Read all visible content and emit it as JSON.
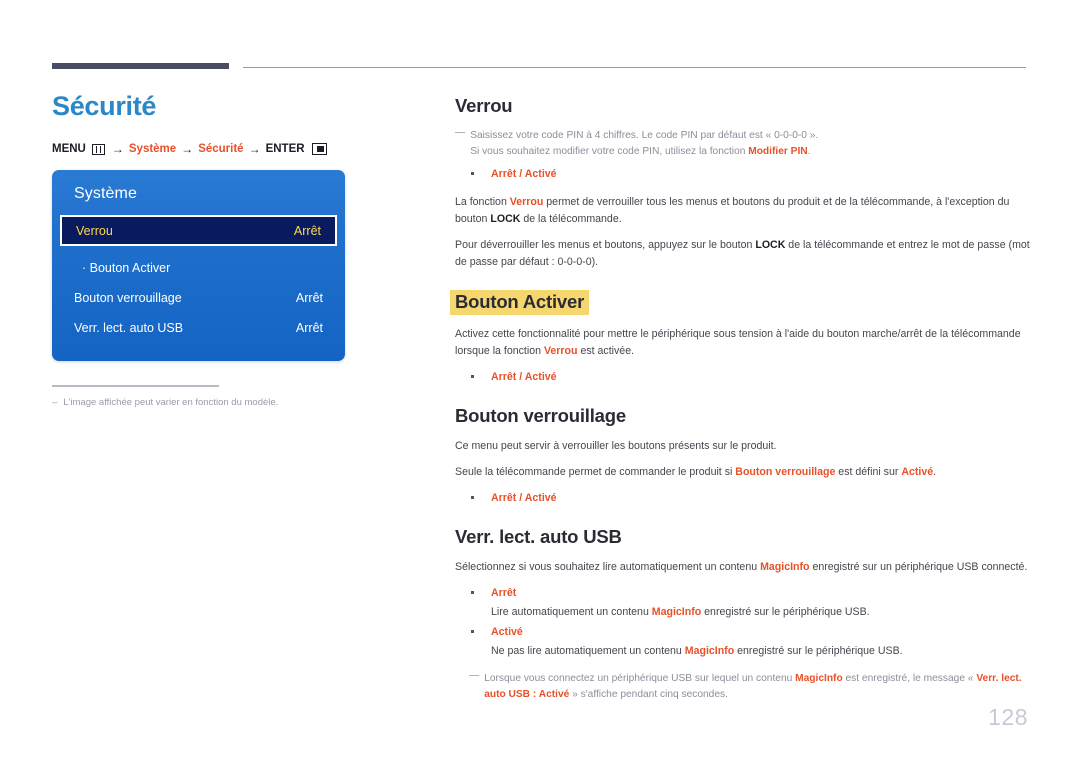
{
  "page": {
    "title": "Sécurité",
    "number": "128",
    "accent_color": "#2a87c8",
    "highlight_color": "#f5d76e",
    "link_color": "#e8512a"
  },
  "menu_path": {
    "prefix": "MENU",
    "menu_icon": "menu-grid-icon",
    "arrow": "→",
    "step1": "Système",
    "step2": "Sécurité",
    "enter": "ENTER",
    "enter_icon": "enter-key-icon"
  },
  "osd": {
    "title": "Système",
    "rows": [
      {
        "label": "Verrou",
        "value": "Arrêt",
        "selected": true,
        "sub": false
      },
      {
        "label": "Bouton Activer",
        "value": "",
        "selected": false,
        "sub": true
      },
      {
        "label": "Bouton verrouillage",
        "value": "Arrêt",
        "selected": false,
        "sub": false
      },
      {
        "label": "Verr. lect. auto USB",
        "value": "Arrêt",
        "selected": false,
        "sub": false
      }
    ]
  },
  "left_note": {
    "dash": "‒",
    "text": "L'image affichée peut varier en fonction du modèle."
  },
  "sections": {
    "verrou": {
      "heading": "Verrou",
      "note_dash": "—",
      "note_line1": "Saisissez votre code PIN à 4 chiffres. Le code PIN par défaut est « 0-0-0-0 ».",
      "note_line2_a": "Si vous souhaitez modifier votre code PIN, utilisez la fonction ",
      "note_line2_b": "Modifier PIN",
      "note_line2_c": ".",
      "options": [
        "Arrêt / Activé"
      ],
      "para1_a": "La fonction ",
      "para1_b": "Verrou",
      "para1_c": " permet de verrouiller tous les menus et boutons du produit et de la télécommande, à l'exception du bouton ",
      "para1_d": "LOCK",
      "para1_e": " de la télécommande.",
      "para2_a": "Pour déverrouiller les menus et boutons, appuyez sur le bouton ",
      "para2_b": "LOCK",
      "para2_c": " de la télécommande et entrez le mot de passe (mot de passe par défaut : 0-0-0-0)."
    },
    "bouton_activer": {
      "heading": "Bouton Activer",
      "highlighted": true,
      "para1_a": "Activez cette fonctionnalité pour mettre le périphérique sous tension à l'aide du bouton marche/arrêt de la télécommande lorsque la fonction ",
      "para1_b": "Verrou",
      "para1_c": " est activée.",
      "options": [
        "Arrêt / Activé"
      ]
    },
    "bouton_verrouillage": {
      "heading": "Bouton verrouillage",
      "para1": "Ce menu peut servir à verrouiller les boutons présents sur le produit.",
      "para2_a": "Seule la télécommande permet de commander le produit si ",
      "para2_b": "Bouton verrouillage",
      "para2_c": " est défini sur ",
      "para2_d": "Activé",
      "para2_e": ".",
      "options": [
        "Arrêt / Activé"
      ]
    },
    "verr_lect_auto_usb": {
      "heading": "Verr. lect. auto USB",
      "para1_a": "Sélectionnez si vous souhaitez lire automatiquement un contenu ",
      "para1_b": "MagicInfo",
      "para1_c": " enregistré sur un périphérique USB connecté.",
      "opt1_label": "Arrêt",
      "opt1_desc_a": "Lire automatiquement un contenu ",
      "opt1_desc_b": "MagicInfo",
      "opt1_desc_c": " enregistré sur le périphérique USB.",
      "opt2_label": "Activé",
      "opt2_desc_a": "Ne pas lire automatiquement un contenu ",
      "opt2_desc_b": "MagicInfo",
      "opt2_desc_c": " enregistré sur le périphérique USB.",
      "note_dash": "—",
      "note_a": "Lorsque vous connectez un périphérique USB sur lequel un contenu ",
      "note_b": "MagicInfo",
      "note_c": " est enregistré, le message « ",
      "note_d": "Verr. lect. auto USB : Activé",
      "note_e": " » s'affiche pendant cinq secondes."
    }
  }
}
